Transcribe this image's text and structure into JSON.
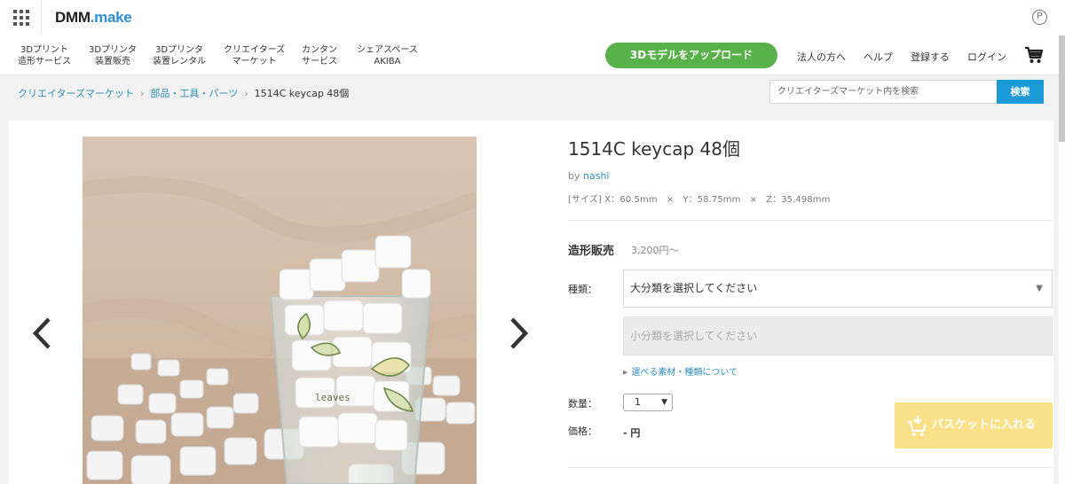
{
  "header": {
    "logo_main": "DMM",
    "logo_dot": ".",
    "logo_make": "make",
    "point_icon": "P"
  },
  "nav": {
    "items": [
      {
        "line1": "3Dプリント",
        "line2": "造形サービス"
      },
      {
        "line1": "3Dプリンタ",
        "line2": "装置販売"
      },
      {
        "line1": "3Dプリンタ",
        "line2": "装置レンタル"
      },
      {
        "line1": "クリエイターズ",
        "line2": "マーケット"
      },
      {
        "line1": "カンタン",
        "line2": "サービス"
      },
      {
        "line1": "シェアスペース",
        "line2": "AKIBA"
      }
    ],
    "upload_label": "3Dモデルをアップロード",
    "links": [
      "法人の方へ",
      "ヘルプ",
      "登録する",
      "ログイン"
    ]
  },
  "breadcrumb": {
    "items": [
      "クリエイターズマーケット",
      "部品・工具・パーツ"
    ],
    "current": "1514C keycap 48個",
    "separator": "›"
  },
  "search": {
    "placeholder": "クリエイターズマーケット内を検索",
    "button": "検索"
  },
  "product": {
    "title": "1514C keycap 48個",
    "by": "by",
    "author": "nashi",
    "size": "[サイズ] X：60.5mm　×　Y：58.75mm　×　Z：35.498mm",
    "sale_label": "造形販売",
    "sale_price": "3,200円〜",
    "type_label": "種類：",
    "type_select": "大分類を選択してください",
    "subtype_select": "小分類を選択してください",
    "material_link": "選べる素材・種類について",
    "qty_label": "数量：",
    "qty_value": "1",
    "price_label": "価格：",
    "price_value": "- 円",
    "basket_label": "バスケットに入れる",
    "photo_text": "leaves"
  },
  "colors": {
    "upload_green": "#58b149",
    "link_blue": "#2d8fbd",
    "search_blue": "#1a9ad6",
    "basket_yellow": "#fbe08a"
  }
}
